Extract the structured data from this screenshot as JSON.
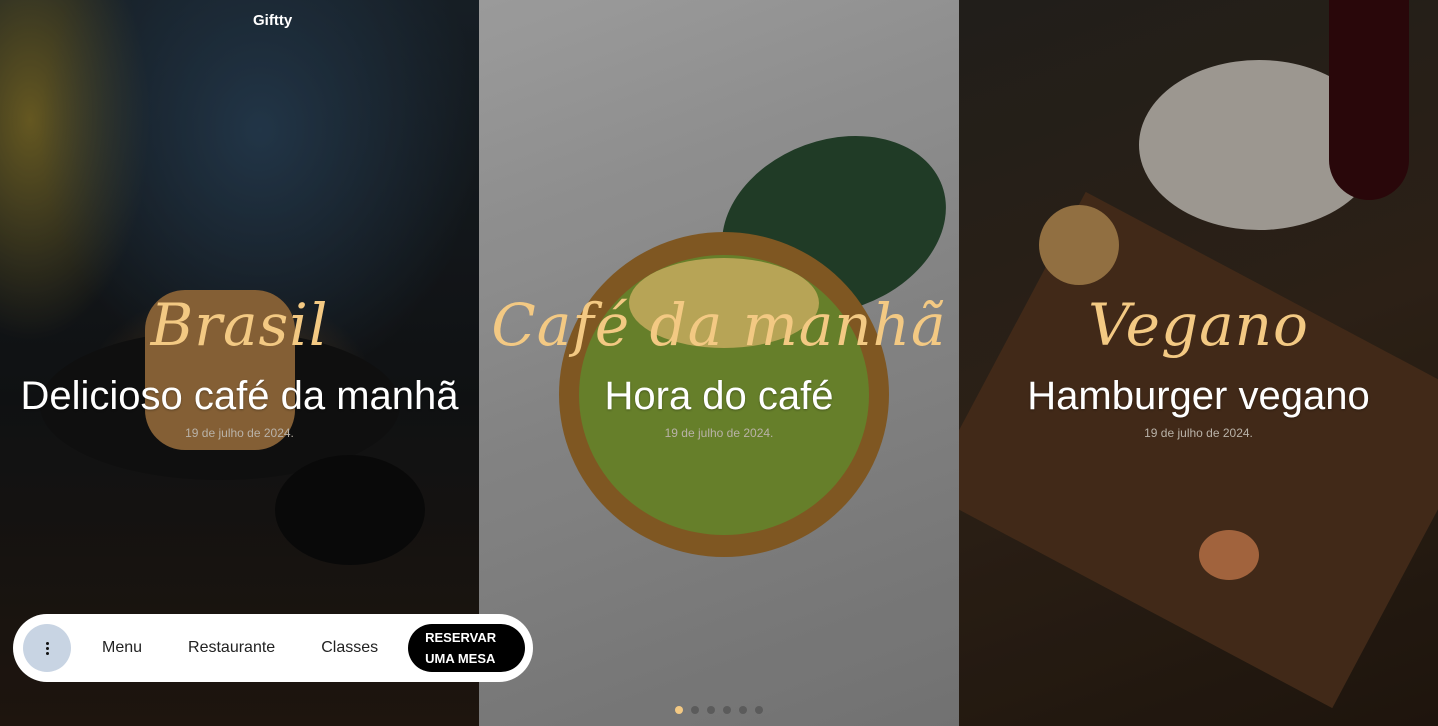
{
  "brand": "Giftty",
  "slides": [
    {
      "script_title": "Brasil",
      "headline": "Delicioso café da manhã",
      "date": "19 de julho de 2024."
    },
    {
      "script_title": "Café da manhã",
      "headline": "Hora do café",
      "date": "19 de julho de 2024."
    },
    {
      "script_title": "Vegano",
      "headline": "Hamburger vegano",
      "date": "19 de julho de 2024."
    }
  ],
  "nav": {
    "menu_icon": "kebab-menu-icon",
    "links": [
      "Menu",
      "Restaurante",
      "Classes"
    ],
    "cta": "RESERVAR\nUMA MESA"
  },
  "pager": {
    "count": 6,
    "active_index": 0
  },
  "colors": {
    "accent": "#f3c983",
    "nav_background": "#ffffff",
    "cta_background": "#000000",
    "menu_button": "#c8d4e3"
  }
}
